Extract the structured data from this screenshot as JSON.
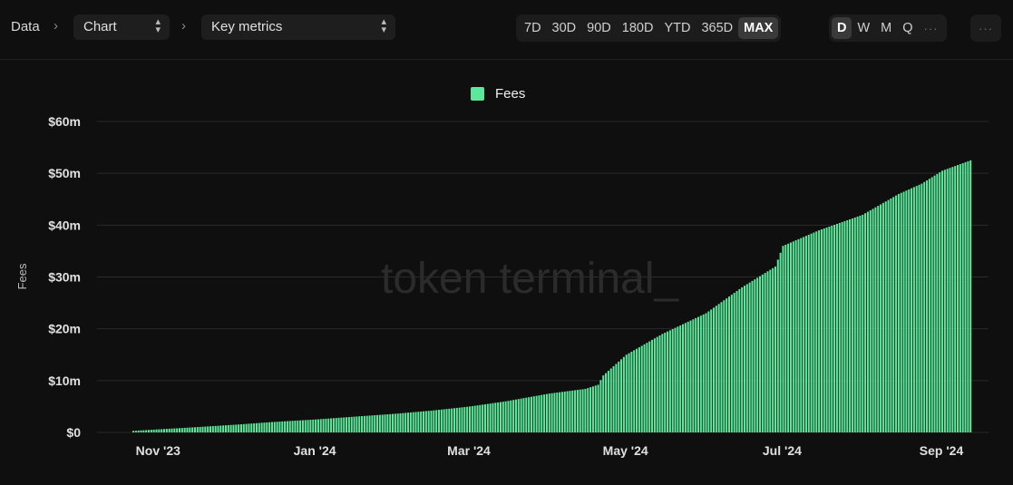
{
  "toolbar": {
    "breadcrumb": "Data",
    "chart_select": "Chart",
    "metric_select": "Key metrics",
    "ranges": [
      "7D",
      "30D",
      "90D",
      "180D",
      "YTD",
      "365D",
      "MAX"
    ],
    "active_range": "MAX",
    "granularities": [
      "D",
      "W",
      "M",
      "Q"
    ],
    "active_granularity": "D",
    "more_glyph": "···",
    "menu_glyph": "···"
  },
  "watermark": "token terminal_",
  "colors": {
    "background": "#0f0f0f",
    "bar": "#5ce89a",
    "grid": "#2a2a2a"
  },
  "chart_data": {
    "type": "bar",
    "cumulative": true,
    "title": "",
    "xlabel": "",
    "ylabel": "Fees",
    "ylim": [
      0,
      60
    ],
    "y_unit": "USD millions",
    "y_ticks": [
      "$0",
      "$10m",
      "$20m",
      "$30m",
      "$40m",
      "$50m",
      "$60m"
    ],
    "x_ticks": [
      "Nov '23",
      "Jan '24",
      "Mar '24",
      "May '24",
      "Jul '24",
      "Sep '24"
    ],
    "x_range": [
      "2023-10-22",
      "2024-09-12"
    ],
    "legend": {
      "position": "top-center",
      "entries": [
        "Fees"
      ]
    },
    "grid": true,
    "series": [
      {
        "name": "Fees",
        "color": "#5ce89a",
        "frequency": "daily",
        "points": [
          [
            "2023-10-22",
            0.3
          ],
          [
            "2023-11-01",
            0.6
          ],
          [
            "2023-11-15",
            1.0
          ],
          [
            "2023-12-01",
            1.5
          ],
          [
            "2023-12-15",
            2.0
          ],
          [
            "2024-01-01",
            2.5
          ],
          [
            "2024-01-15",
            3.0
          ],
          [
            "2024-02-01",
            3.6
          ],
          [
            "2024-02-15",
            4.2
          ],
          [
            "2024-03-01",
            5.0
          ],
          [
            "2024-03-15",
            6.0
          ],
          [
            "2024-04-01",
            7.5
          ],
          [
            "2024-04-15",
            8.4
          ],
          [
            "2024-04-20",
            9.2
          ],
          [
            "2024-04-22",
            11.0
          ],
          [
            "2024-05-01",
            15.0
          ],
          [
            "2024-05-15",
            19.0
          ],
          [
            "2024-06-01",
            23.0
          ],
          [
            "2024-06-15",
            28.0
          ],
          [
            "2024-06-28",
            32.0
          ],
          [
            "2024-07-01",
            36.0
          ],
          [
            "2024-07-15",
            39.0
          ],
          [
            "2024-08-01",
            42.0
          ],
          [
            "2024-08-15",
            46.0
          ],
          [
            "2024-08-24",
            48.0
          ],
          [
            "2024-09-01",
            50.5
          ],
          [
            "2024-09-12",
            52.5
          ]
        ]
      }
    ]
  }
}
